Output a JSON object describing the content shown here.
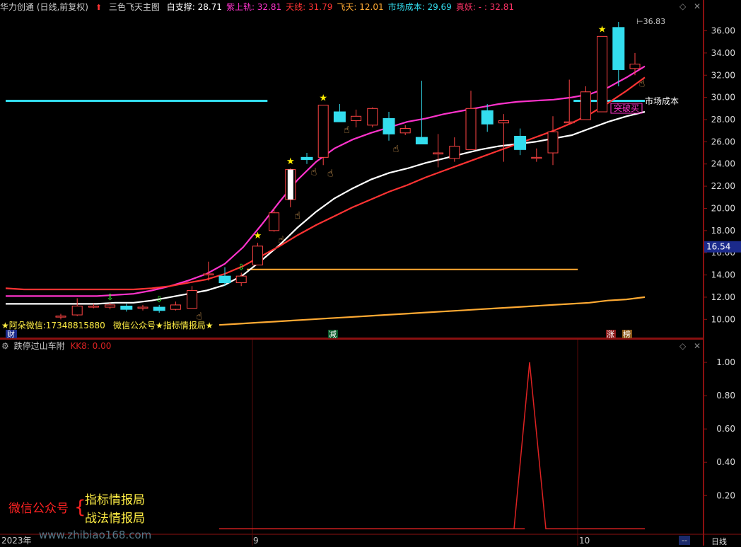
{
  "header": {
    "stock_name": "华力创通 (日线,前复权)",
    "indicator_name": "三色飞天主图",
    "items": [
      {
        "label": "白支撑:",
        "value": "28.71",
        "color": "#ffffff"
      },
      {
        "label": "紫上轨:",
        "value": "32.81",
        "color": "#ff33cc"
      },
      {
        "label": "天线:",
        "value": "31.79",
        "color": "#ff3333"
      },
      {
        "label": "飞天:",
        "value": "12.01",
        "color": "#ffaa33"
      },
      {
        "label": "市场成本:",
        "value": "29.69",
        "color": "#33ddee"
      },
      {
        "label": "真妖:",
        "value": "- : 32.81",
        "color": "#ff3366"
      }
    ],
    "icons": [
      "diamond-icon",
      "up-arrow-icon",
      "close-icon"
    ]
  },
  "sub_header": {
    "name": "跌停过山车附",
    "kk8": "KK8: 0.00"
  },
  "annotations": {
    "max_price_label": "36.83",
    "market_cost_label": "市场成本",
    "breakout_label": "突破买",
    "contact_line": "★阿朵微信:17348815880",
    "wechat_line": "微信公众号★指标情报局★",
    "cai_label": "财",
    "jian_label": "减",
    "zhang_label": "涨",
    "bang_label": "榜",
    "promo_title": "微信公众号",
    "promo_line1": "指标情报局",
    "promo_line2": "战法情报局",
    "watermark": "www.zhibiao168.com",
    "current_price": "16.54",
    "date_labels": [
      "2023年",
      "9",
      "10"
    ],
    "period_tab": "日线",
    "tab_dash": "--"
  },
  "chart_data": [
    {
      "type": "candlestick",
      "title": "三色飞天主图",
      "ylim": [
        9,
        37.5
      ],
      "yticks": [
        10.0,
        12.0,
        14.0,
        16.0,
        18.0,
        20.0,
        22.0,
        24.0,
        26.0,
        28.0,
        30.0,
        32.0,
        34.0,
        36.0
      ],
      "candles": [
        {
          "o": 10.3,
          "c": 10.3,
          "h": 10.5,
          "l": 10.0
        },
        {
          "o": 10.4,
          "c": 11.2,
          "h": 11.9,
          "l": 10.3
        },
        {
          "o": 11.1,
          "c": 11.2,
          "h": 11.4,
          "l": 11.0
        },
        {
          "o": 11.1,
          "c": 11.3,
          "h": 11.5,
          "l": 10.9
        },
        {
          "o": 11.2,
          "c": 10.9,
          "h": 11.4,
          "l": 10.7
        },
        {
          "o": 11.0,
          "c": 11.1,
          "h": 11.3,
          "l": 10.8
        },
        {
          "o": 11.1,
          "c": 10.8,
          "h": 11.3,
          "l": 10.6
        },
        {
          "o": 10.9,
          "c": 11.3,
          "h": 11.6,
          "l": 10.8
        },
        {
          "o": 11.0,
          "c": 12.6,
          "h": 13.0,
          "l": 11.0
        },
        {
          "o": 14.0,
          "c": 14.1,
          "h": 15.2,
          "l": 13.5
        },
        {
          "o": 13.9,
          "c": 13.3,
          "h": 14.7,
          "l": 13.0
        },
        {
          "o": 13.3,
          "c": 13.9,
          "h": 14.2,
          "l": 13.0
        },
        {
          "o": 14.9,
          "c": 16.6,
          "h": 16.9,
          "l": 14.9
        },
        {
          "o": 18.0,
          "c": 19.6,
          "h": 20.0,
          "l": 17.9
        },
        {
          "o": 20.8,
          "c": 23.5,
          "h": 23.6,
          "l": 20.1
        },
        {
          "o": 24.6,
          "c": 24.4,
          "h": 25.0,
          "l": 24.0
        },
        {
          "o": 24.6,
          "c": 29.3,
          "h": 29.3,
          "l": 23.9
        },
        {
          "o": 28.7,
          "c": 27.8,
          "h": 29.4,
          "l": 27.8
        },
        {
          "o": 27.9,
          "c": 28.3,
          "h": 28.9,
          "l": 27.3
        },
        {
          "o": 27.5,
          "c": 29.0,
          "h": 29.1,
          "l": 27.3
        },
        {
          "o": 28.1,
          "c": 26.7,
          "h": 28.7,
          "l": 26.1
        },
        {
          "o": 26.8,
          "c": 27.2,
          "h": 27.5,
          "l": 26.6
        },
        {
          "o": 26.4,
          "c": 25.8,
          "h": 31.5,
          "l": 25.8
        },
        {
          "o": 24.9,
          "c": 25.0,
          "h": 26.7,
          "l": 23.7
        },
        {
          "o": 24.5,
          "c": 25.6,
          "h": 26.4,
          "l": 24.2
        },
        {
          "o": 25.3,
          "c": 29.0,
          "h": 30.6,
          "l": 25.3
        },
        {
          "o": 28.8,
          "c": 27.6,
          "h": 29.4,
          "l": 26.9
        },
        {
          "o": 27.7,
          "c": 27.9,
          "h": 28.5,
          "l": 24.2
        },
        {
          "o": 26.5,
          "c": 25.3,
          "h": 27.2,
          "l": 24.8
        },
        {
          "o": 24.6,
          "c": 24.6,
          "h": 25.4,
          "l": 24.2
        },
        {
          "o": 25.0,
          "c": 26.9,
          "h": 28.3,
          "l": 23.9
        },
        {
          "o": 27.8,
          "c": 27.8,
          "h": 31.6,
          "l": 27.6
        },
        {
          "o": 28.0,
          "c": 30.5,
          "h": 31.0,
          "l": 28.0
        },
        {
          "o": 28.7,
          "c": 35.5,
          "h": 35.5,
          "l": 28.7
        },
        {
          "o": 36.3,
          "c": 32.5,
          "h": 36.8,
          "l": 31.0
        },
        {
          "o": 32.6,
          "c": 33.0,
          "h": 34.0,
          "l": 32.0
        }
      ],
      "series": [
        {
          "name": "白支撑",
          "color": "#ffffff",
          "start": 0,
          "values": [
            11.4,
            11.4,
            11.4,
            11.4,
            11.4,
            11.4,
            11.5,
            11.5,
            11.7,
            12.0,
            12.3,
            12.6,
            13.1,
            14.0,
            15.3,
            16.7,
            18.3,
            19.7,
            20.9,
            21.8,
            22.6,
            23.2,
            23.6,
            24.1,
            24.5,
            24.9,
            25.3,
            25.6,
            25.8,
            26.0,
            26.3,
            26.6,
            27.2,
            27.8,
            28.3,
            28.7
          ]
        },
        {
          "name": "紫上轨",
          "color": "#ff33cc",
          "start": 0,
          "values": [
            12.1,
            12.1,
            12.1,
            12.1,
            12.1,
            12.1,
            12.2,
            12.3,
            12.6,
            13.0,
            13.5,
            14.1,
            15.0,
            16.5,
            18.5,
            20.6,
            22.6,
            24.2,
            25.4,
            26.2,
            26.8,
            27.3,
            27.8,
            28.1,
            28.5,
            28.8,
            29.1,
            29.4,
            29.6,
            29.7,
            29.8,
            30.0,
            30.3,
            30.9,
            31.8,
            32.8
          ]
        },
        {
          "name": "天线",
          "color": "#ff3333",
          "start": 0,
          "values": [
            12.8,
            12.7,
            12.7,
            12.7,
            12.7,
            12.7,
            12.7,
            12.7,
            12.8,
            13.0,
            13.3,
            13.6,
            14.1,
            14.8,
            15.7,
            16.6,
            17.6,
            18.5,
            19.3,
            20.1,
            20.8,
            21.5,
            22.1,
            22.8,
            23.4,
            24.0,
            24.6,
            25.2,
            25.8,
            26.4,
            27.0,
            27.7,
            28.5,
            29.5,
            30.6,
            31.8
          ]
        },
        {
          "name": "飞天",
          "color": "#ffaa33",
          "start": 12,
          "values": [
            9.5,
            9.6,
            9.7,
            9.8,
            9.9,
            10.0,
            10.1,
            10.2,
            10.3,
            10.4,
            10.5,
            10.6,
            10.7,
            10.8,
            10.9,
            11.0,
            11.1,
            11.2,
            11.3,
            11.4,
            11.5,
            11.7,
            11.8,
            12.0
          ]
        }
      ],
      "levels": [
        {
          "name": "市场成本",
          "value": 29.69,
          "color": "#33ddee",
          "from": 0,
          "to": 13
        },
        {
          "name": "市场成本",
          "value": 29.69,
          "color": "#33ddee",
          "from": 32,
          "to": 39
        },
        {
          "name": "",
          "value": 14.5,
          "color": "#ffaa33",
          "from": 12,
          "to": 32
        }
      ],
      "stars": [
        12,
        14,
        16,
        33
      ],
      "hands": [
        8,
        13,
        14,
        15,
        16,
        17,
        20,
        37
      ],
      "green_arrows": [
        3,
        6,
        11
      ]
    },
    {
      "type": "line",
      "title": "跌停过山车附",
      "ylim": [
        -0.02,
        1.06
      ],
      "yticks": [
        0.2,
        0.4,
        0.6,
        0.8,
        1.0
      ],
      "series": [
        {
          "name": "KK8",
          "color": "#dd2222",
          "values": [
            0,
            0,
            0,
            0,
            0,
            0,
            0,
            0,
            0,
            0,
            0,
            0,
            0,
            0,
            0,
            0,
            0,
            0,
            0,
            0,
            0,
            0,
            0,
            0,
            0,
            0,
            0,
            0,
            0,
            0,
            1,
            0,
            0,
            0,
            0,
            0,
            0,
            0,
            0,
            0
          ]
        }
      ]
    }
  ]
}
